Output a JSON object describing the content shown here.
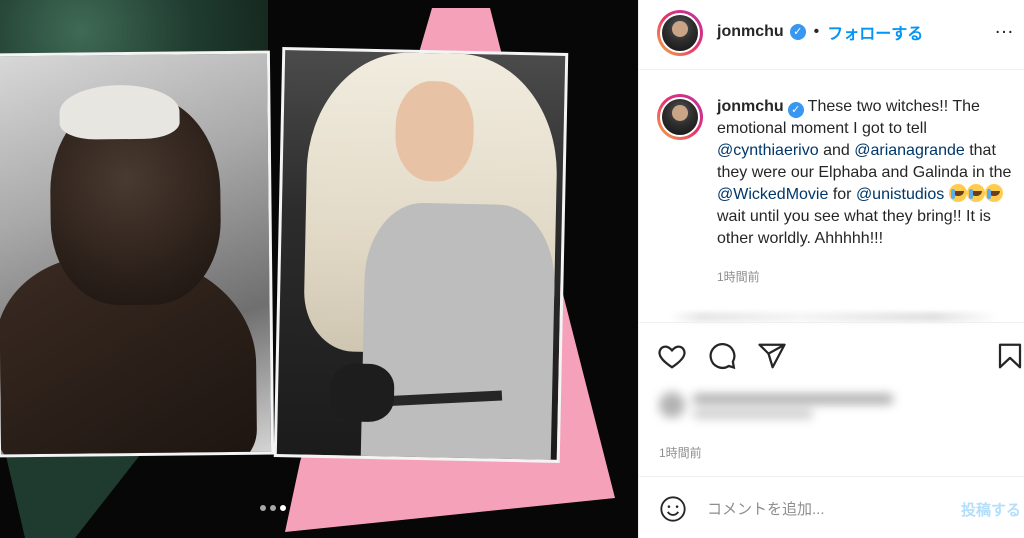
{
  "post": {
    "carousel": {
      "total_slides": 3,
      "active_slide_index": 2
    }
  },
  "header": {
    "username": "jonmchu",
    "separator": "•",
    "follow_label": "フォローする",
    "more_label": "…"
  },
  "caption": {
    "username": "jonmchu",
    "segments": [
      {
        "type": "text",
        "text": "These two witches!! The emotional moment I got to tell "
      },
      {
        "type": "mention",
        "text": "@cynthiaerivo"
      },
      {
        "type": "text",
        "text": " and "
      },
      {
        "type": "mention",
        "text": "@arianagrande"
      },
      {
        "type": "text",
        "text": " that they were our Elphaba and Galinda in the "
      },
      {
        "type": "mention",
        "text": "@WickedMovie"
      },
      {
        "type": "text",
        "text": " for "
      },
      {
        "type": "mention",
        "text": "@unistudios"
      },
      {
        "type": "text",
        "text": " "
      },
      {
        "type": "emoji",
        "name": "loudly-crying-face"
      },
      {
        "type": "emoji",
        "name": "loudly-crying-face"
      },
      {
        "type": "emoji",
        "name": "loudly-crying-face"
      },
      {
        "type": "text",
        "text": "wait until you see what they bring!! It is other worldly. Ahhhhh!!!"
      }
    ],
    "time": "1時間前"
  },
  "post_time": "1時間前",
  "comment": {
    "placeholder": "コメントを追加...",
    "post_label": "投稿する"
  },
  "colors": {
    "link_blue": "#0095f6",
    "mention_blue": "#00376b",
    "muted_text": "#8e8e8e",
    "pink_accent": "#f6a1ba",
    "dark_green": "#1f3b2f"
  },
  "icons": [
    "verified-badge-icon",
    "more-options-icon",
    "heart-icon",
    "comment-icon",
    "share-icon",
    "bookmark-icon",
    "emoji-smile-icon"
  ]
}
